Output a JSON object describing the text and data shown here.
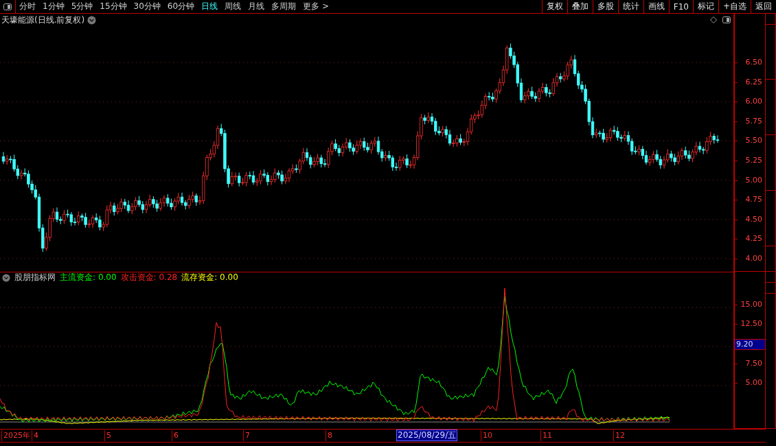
{
  "toolbar": {
    "periods": [
      {
        "label": "分时",
        "selected": false
      },
      {
        "label": "1分钟",
        "selected": false
      },
      {
        "label": "5分钟",
        "selected": false
      },
      {
        "label": "15分钟",
        "selected": false
      },
      {
        "label": "30分钟",
        "selected": false
      },
      {
        "label": "60分钟",
        "selected": false
      },
      {
        "label": "日线",
        "selected": true
      },
      {
        "label": "周线",
        "selected": false
      },
      {
        "label": "月线",
        "selected": false
      },
      {
        "label": "多周期",
        "selected": false
      },
      {
        "label": "更多 >",
        "selected": false
      }
    ],
    "actions": [
      "复权",
      "叠加",
      "多股",
      "统计",
      "画线",
      "F10",
      "标记",
      "+自选",
      "返回"
    ]
  },
  "chart_title": "天壕能源(日线.前复权)",
  "price_axis": [
    "6.50",
    "6.25",
    "6.00",
    "5.75",
    "5.50",
    "5.25",
    "5.00",
    "4.75",
    "4.50",
    "4.25",
    "4.00"
  ],
  "indicator": {
    "name": "股朋指标网",
    "values": [
      {
        "label": "主流资金:",
        "value": "0.00",
        "color": "#00ff00"
      },
      {
        "label": "攻击资金:",
        "value": "0.28",
        "color": "#ff2020"
      },
      {
        "label": "流存资金:",
        "value": "0.00",
        "color": "#ffff00"
      }
    ]
  },
  "indicator_axis": {
    "labels": [
      "15.00",
      "12.50",
      "7.50",
      "5.00"
    ],
    "cursor_value": "9.20"
  },
  "date_axis": {
    "labels": [
      "2025年",
      "4",
      "5",
      "6",
      "7",
      "8",
      "10",
      "11",
      "12"
    ],
    "cursor_date": "2025/08/29/五"
  }
}
